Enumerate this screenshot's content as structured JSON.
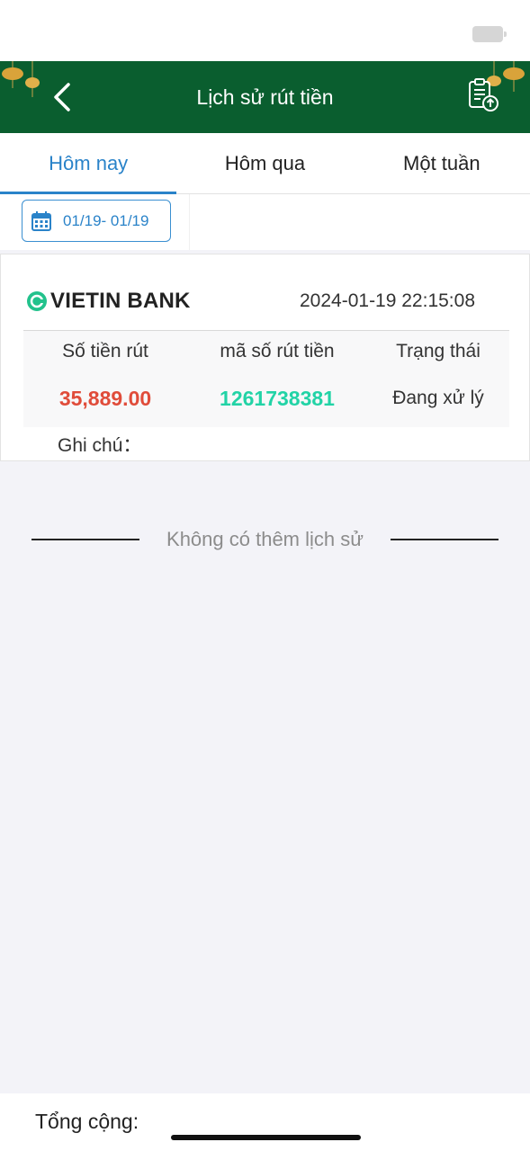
{
  "header": {
    "title": "Lịch sử rút tiền"
  },
  "tabs": [
    {
      "label": "Hôm nay",
      "active": true
    },
    {
      "label": "Hôm qua",
      "active": false
    },
    {
      "label": "Một tuần",
      "active": false
    }
  ],
  "filter": {
    "date_range": "01/19- 01/19"
  },
  "record": {
    "bank": "VIETIN BANK",
    "datetime": "2024-01-19 22:15:08",
    "columns": [
      "Số tiền rút",
      "mã số rút tiền",
      "Trạng thái"
    ],
    "amount": "35,889.00",
    "code": "1261738381",
    "status": "Đang xử lý",
    "note_label": "Ghi chú："
  },
  "empty": {
    "message": "Không có thêm lịch sử"
  },
  "footer": {
    "total_label": "Tổng cộng:"
  },
  "colors": {
    "header_bg": "#0a5e2f",
    "accent": "#2a83c9",
    "amount": "#e04c3a",
    "code": "#22d3a6"
  }
}
